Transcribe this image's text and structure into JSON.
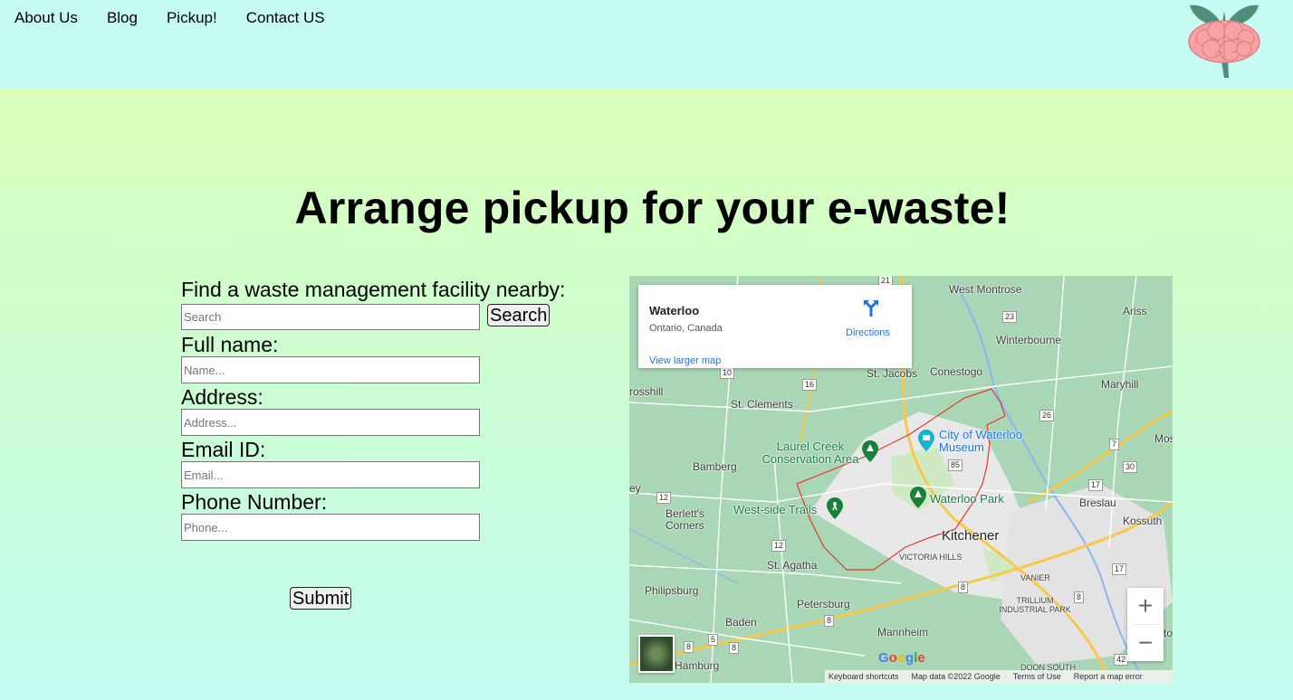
{
  "nav": {
    "items": [
      "About Us",
      "Blog",
      "Pickup!",
      "Contact US"
    ]
  },
  "main": {
    "title": "Arrange pickup for your e-waste!"
  },
  "form": {
    "facility_label": "Find a waste management facility nearby:",
    "search_placeholder": "Search",
    "search_button": "Search",
    "name_label": "Full name:",
    "name_placeholder": "Name...",
    "address_label": "Address:",
    "address_placeholder": "Address...",
    "email_label": "Email ID:",
    "email_placeholder": "Email...",
    "phone_label": "Phone Number:",
    "phone_placeholder": "Phone...",
    "submit_button": "Submit"
  },
  "map": {
    "card": {
      "name": "Waterloo",
      "region": "Ontario, Canada",
      "directions": "Directions",
      "larger_map": "View larger map"
    },
    "places": {
      "west_montrose": "West Montrose",
      "ariss": "Ariss",
      "winterbourne": "Winterbourne",
      "st_jacobs": "St. Jacobs",
      "conestogo": "Conestogo",
      "maryhill": "Maryhill",
      "crosshill": "rosshill",
      "st_clements": "St. Clements",
      "mosbo": "Mosbo",
      "bamberg": "Bamberg",
      "breslau": "Breslau",
      "berletts": "Berlett's Corners",
      "kossuth": "Kossuth",
      "kitchener": "Kitchener",
      "victoria_hills": "VICTORIA HILLS",
      "st_agatha": "St. Agatha",
      "vanier": "VANIER",
      "philipsburg": "Philipsburg",
      "petersburg": "Petersburg",
      "trillium": "TRILLIUM INDUSTRIAL PARK",
      "baden": "Baden",
      "mannheim": "Mannheim",
      "hamburg": "Hamburg",
      "doon_south": "DOON SOUTH",
      "ey": "ey",
      "to": "to"
    },
    "pois": {
      "laurel_creek": "Laurel Creek Conservation Area",
      "city_museum": "City of Waterloo Museum",
      "waterloo_park": "Waterloo Park",
      "westside_trails": "West-side Trails"
    },
    "routes": [
      "21",
      "23",
      "16",
      "10",
      "26",
      "7",
      "85",
      "17",
      "30",
      "12",
      "12",
      "8",
      "8",
      "8",
      "17",
      "8",
      "5",
      "8",
      "42"
    ],
    "footer": {
      "shortcuts": "Keyboard shortcuts",
      "data": "Map data ©2022 Google",
      "terms": "Terms of Use",
      "report": "Report a map error"
    },
    "google": "Google",
    "zoom_in": "+",
    "zoom_out": "−"
  }
}
